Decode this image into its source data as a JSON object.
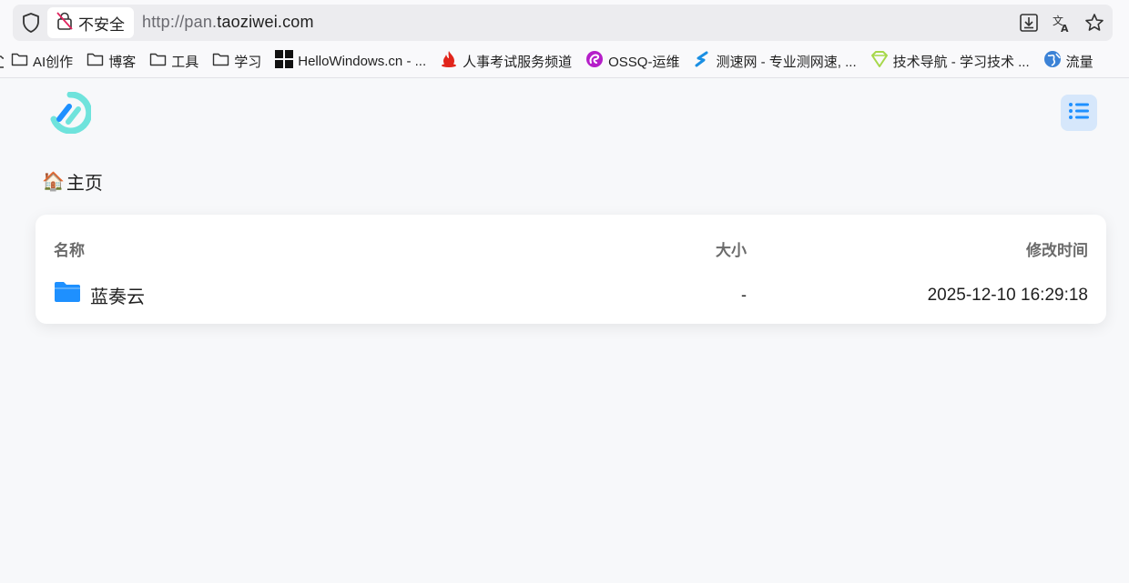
{
  "browser": {
    "insecure_label": "不安全",
    "url_prefix": "http://pan.",
    "url_host": "taoziwei.com"
  },
  "bookmarks": [
    {
      "label": "AI创作",
      "icon": "folder-icon"
    },
    {
      "label": "博客",
      "icon": "folder-icon"
    },
    {
      "label": "工具",
      "icon": "folder-icon"
    },
    {
      "label": "学习",
      "icon": "folder-icon"
    },
    {
      "label": "HelloWindows.cn - ...",
      "icon": "windows-icon"
    },
    {
      "label": "人事考试服务频道",
      "icon": "fire-icon"
    },
    {
      "label": "OSSQ-运维",
      "icon": "swirl-icon"
    },
    {
      "label": "测速网 - 专业测网速, ...",
      "icon": "s-logo-icon"
    },
    {
      "label": "技术导航 - 学习技术 ...",
      "icon": "diamond-icon"
    },
    {
      "label": "流量",
      "icon": "globe-icon"
    }
  ],
  "breadcrumb": {
    "icon": "🏠",
    "label": "主页"
  },
  "table": {
    "headers": {
      "name": "名称",
      "size": "大小",
      "time": "修改时间"
    },
    "rows": [
      {
        "name": "蓝奏云",
        "size": "-",
        "time": "2025-12-10 16:29:18",
        "icon": "folder-icon"
      }
    ]
  },
  "colors": {
    "accent": "#1e90ff",
    "logo": "#6fe3dc",
    "menu_bg": "#d6e7fb"
  }
}
